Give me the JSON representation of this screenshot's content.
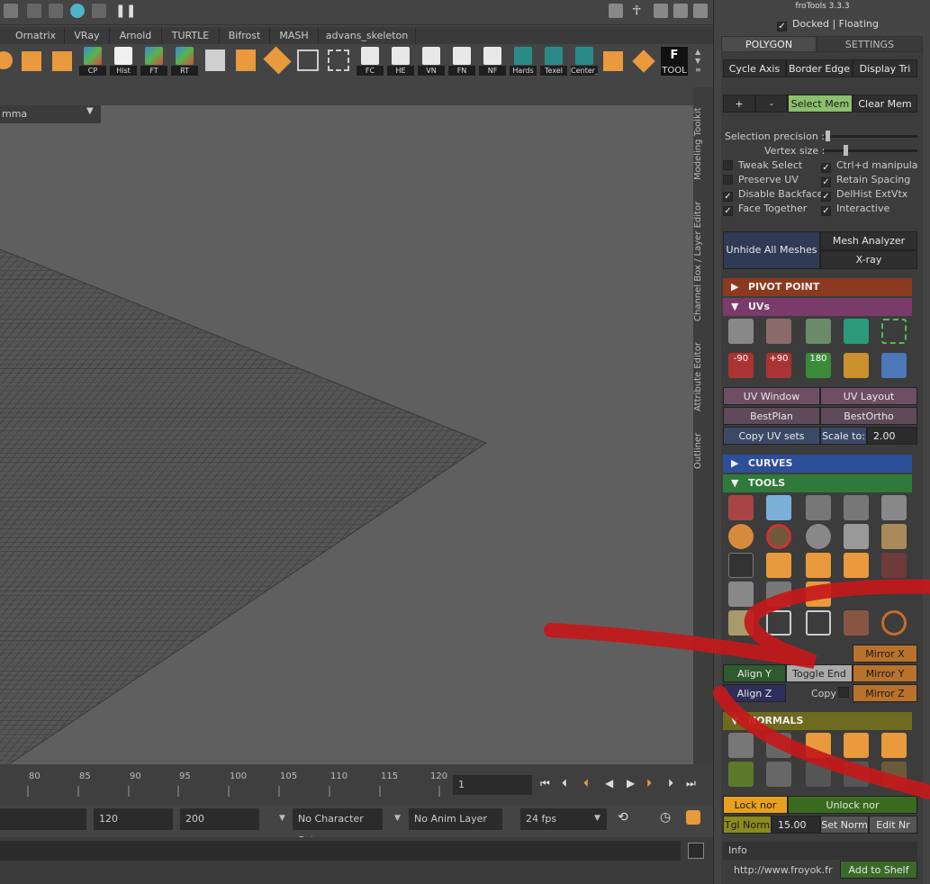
{
  "shelf_tabs": [
    "Ornatrix",
    "VRay",
    "Arnold",
    "TURTLE",
    "Bifrost",
    "MASH",
    "advans_skeleton"
  ],
  "shelf_icons": [
    "CP",
    "Hist",
    "FT",
    "RT",
    "FC",
    "HE",
    "VN",
    "FN",
    "NF",
    "Hards",
    "Texel",
    "Center_",
    "TOOL"
  ],
  "viewport": {
    "camera_field": "mma"
  },
  "side_tabs": [
    "Modeling Toolkit",
    "Channel Box / Layer Editor",
    "Attribute Editor",
    "Outliner"
  ],
  "timeline": {
    "ticks": [
      "80",
      "85",
      "90",
      "95",
      "100",
      "105",
      "110",
      "115",
      "120"
    ],
    "current_frame": "1"
  },
  "range": {
    "end_start": "120",
    "end_max": "200",
    "character_set": "No Character Set",
    "anim_layer": "No Anim Layer",
    "fps": "24 fps"
  },
  "frotools": {
    "title": "froTools 3.3.3",
    "docked_label": "Docked | Floating",
    "tabs": {
      "polygon": "POLYGON",
      "settings": "SETTINGS"
    },
    "row1": [
      "Cycle Axis",
      "Border Edge",
      "Display Tri"
    ],
    "mem": {
      "plus": "+",
      "minus": "-",
      "select": "Select Mem",
      "clear": "Clear Mem"
    },
    "selection_precision": "Selection precision :",
    "vertex_size": "Vertex size :",
    "checks_left": [
      {
        "label": "Tweak Select",
        "checked": false
      },
      {
        "label": "Preserve UV",
        "checked": false
      },
      {
        "label": "Disable Backface",
        "checked": true
      },
      {
        "label": "Face Together",
        "checked": true
      }
    ],
    "checks_right": [
      {
        "label": "Ctrl+d manipulato",
        "checked": true
      },
      {
        "label": "Retain Spacing",
        "checked": true
      },
      {
        "label": "DelHist ExtVtx",
        "checked": true
      },
      {
        "label": "Interactive",
        "checked": true
      }
    ],
    "unhide": "Unhide All Meshes",
    "mesh_analyzer": "Mesh Analyzer",
    "xray": "X-ray",
    "sections": {
      "pivot": "PIVOT POINT",
      "uvs": "UVs",
      "curves": "CURVES",
      "tools": "TOOLS",
      "normals": "NORMALS"
    },
    "uv_rot": [
      "-90",
      "+90",
      "180"
    ],
    "uv_buttons": {
      "uv_window": "UV Window",
      "uv_layout": "UV Layout",
      "bestplan": "BestPlan",
      "bestortho": "BestOrtho",
      "copy_uv": "Copy UV sets",
      "scale_to": "Scale to:",
      "scale_value": "2.00"
    },
    "tools_bottom": {
      "align_y": "Align Y",
      "align_z": "Align Z",
      "toggle": "Toggle End",
      "copy": "Copy",
      "mirror_x": "Mirror X",
      "mirror_y": "Mirror Y",
      "mirror_z": "Mirror Z"
    },
    "normals": {
      "lock": "Lock nor",
      "unlock": "Unlock nor",
      "tgl": "Tgl Norm",
      "value": "15.00",
      "set": "Set Norm",
      "edit": "Edit Nr"
    },
    "info": {
      "label": "Info",
      "url": "http://www.froyok.fr",
      "add_shelf": "Add to Shelf"
    }
  },
  "colors": {
    "pivot": "#8b3a1f",
    "uvs": "#7a3a6a",
    "curves": "#2d4f9a",
    "tools": "#2f7a3a",
    "normals": "#6e6a1f",
    "accent_green": "#8cc06e",
    "accent_orange": "#e89a3c",
    "annotation": "#c4191b"
  }
}
